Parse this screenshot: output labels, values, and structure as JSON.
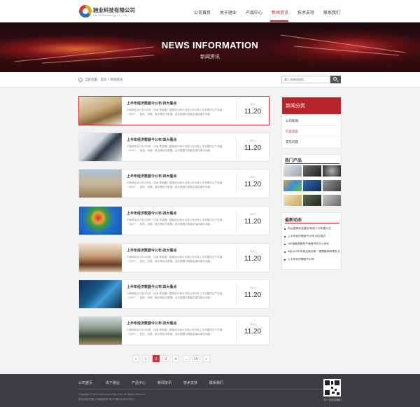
{
  "header": {
    "brand_name": "驰业科技有限公司",
    "brand_sub": "Chi Ye Technology Co., Ltd.",
    "nav": [
      "公司首页",
      "关于驰业",
      "产品中心",
      "新闻资讯",
      "技术支持",
      "联系我们"
    ],
    "active_nav": "新闻资讯"
  },
  "banner": {
    "title": "NEWS INFORMATION",
    "subtitle": "新闻资讯"
  },
  "breadcrumb": {
    "text": "当前位置：首页 > 新闻资讯"
  },
  "search": {
    "placeholder": "输入关键词搜索..."
  },
  "news": [
    {
      "title": "上半年经济数据今公布 四大看点",
      "desc": "中新网北京7月15日电（记者 李金磊）国家统计局今日将公布今年上半年国内生产总值（GDP）、投资、消费、就业等经济数据。此次数据中国能否保持增长动能...",
      "year": "2011",
      "date": "11.20"
    },
    {
      "title": "上半年经济数据今公布 四大看点",
      "desc": "中新网北京7月15日电（记者 李金磊）国家统计局今日将公布今年上半年国内生产总值（GDP）、投资、消费、就业等经济数据。此次数据中国能否保持增长动能...",
      "year": "2011",
      "date": "11.20"
    },
    {
      "title": "上半年经济数据今公布 四大看点",
      "desc": "中新网北京7月15日电（记者 李金磊）国家统计局今日将公布今年上半年国内生产总值（GDP）、投资、消费、就业等经济数据。此次数据中国能否保持增长动能...",
      "year": "2011",
      "date": "11.20"
    },
    {
      "title": "上半年经济数据今公布 四大看点",
      "desc": "中新网北京7月15日电（记者 李金磊）国家统计局今日将公布今年上半年国内生产总值（GDP）、投资、消费、就业等经济数据。此次数据中国能否保持增长动能...",
      "year": "2011",
      "date": "11.20"
    },
    {
      "title": "上半年经济数据今公布 四大看点",
      "desc": "中新网北京7月15日电（记者 李金磊）国家统计局今日将公布今年上半年国内生产总值（GDP）、投资、消费、就业等经济数据。此次数据中国能否保持增长动能...",
      "year": "2011",
      "date": "11.20"
    },
    {
      "title": "上半年经济数据今公布 四大看点",
      "desc": "中新网北京7月15日电（记者 李金磊）国家统计局今日将公布今年上半年国内生产总值（GDP）、投资、消费、就业等经济数据。此次数据中国能否保持增长动能...",
      "year": "2011",
      "date": "11.20"
    },
    {
      "title": "上半年经济数据今公布 四大看点",
      "desc": "中新网北京7月15日电（记者 李金磊）国家统计局今日将公布今年上半年国内生产总值（GDP）、投资、消费、就业等经济数据。此次数据中国能否保持增长动能...",
      "year": "2011",
      "date": "11.20"
    }
  ],
  "pagination": [
    "«",
    "1",
    "2",
    "3",
    "4",
    "...",
    "15",
    "»"
  ],
  "pagination_active": "2",
  "sidebar": {
    "category_title": "新闻分类",
    "categories": [
      "公司新闻",
      "行业动态",
      "常见问题"
    ],
    "active_category": "行业动态",
    "hot_title": "热门产品",
    "recent_title": "最新动态",
    "recent": [
      "尚云整体家居建设 助成下半年重乐活",
      "上半年经济数据今公布 四大看点",
      "100强能源整合户营经济西方入场行",
      "A股公司半年报业绩亮眼：销售额持续增长 超",
      "上半年经济数据今公布"
    ]
  },
  "footer": {
    "links": [
      "公司首页",
      "关于驰业",
      "产品中心",
      "新闻资讯",
      "技术支持",
      "联系我们"
    ],
    "copyright": "Copyright © 2015-2024 www.chiye.com, All Rights Reserved",
    "icp": "驰业科技有限公司版权所有 蜀ICP备12345678号-1",
    "qr_label": "扫一扫关注我们"
  },
  "colors": {
    "accent": "#b42429",
    "footer": "#3b3d42"
  }
}
